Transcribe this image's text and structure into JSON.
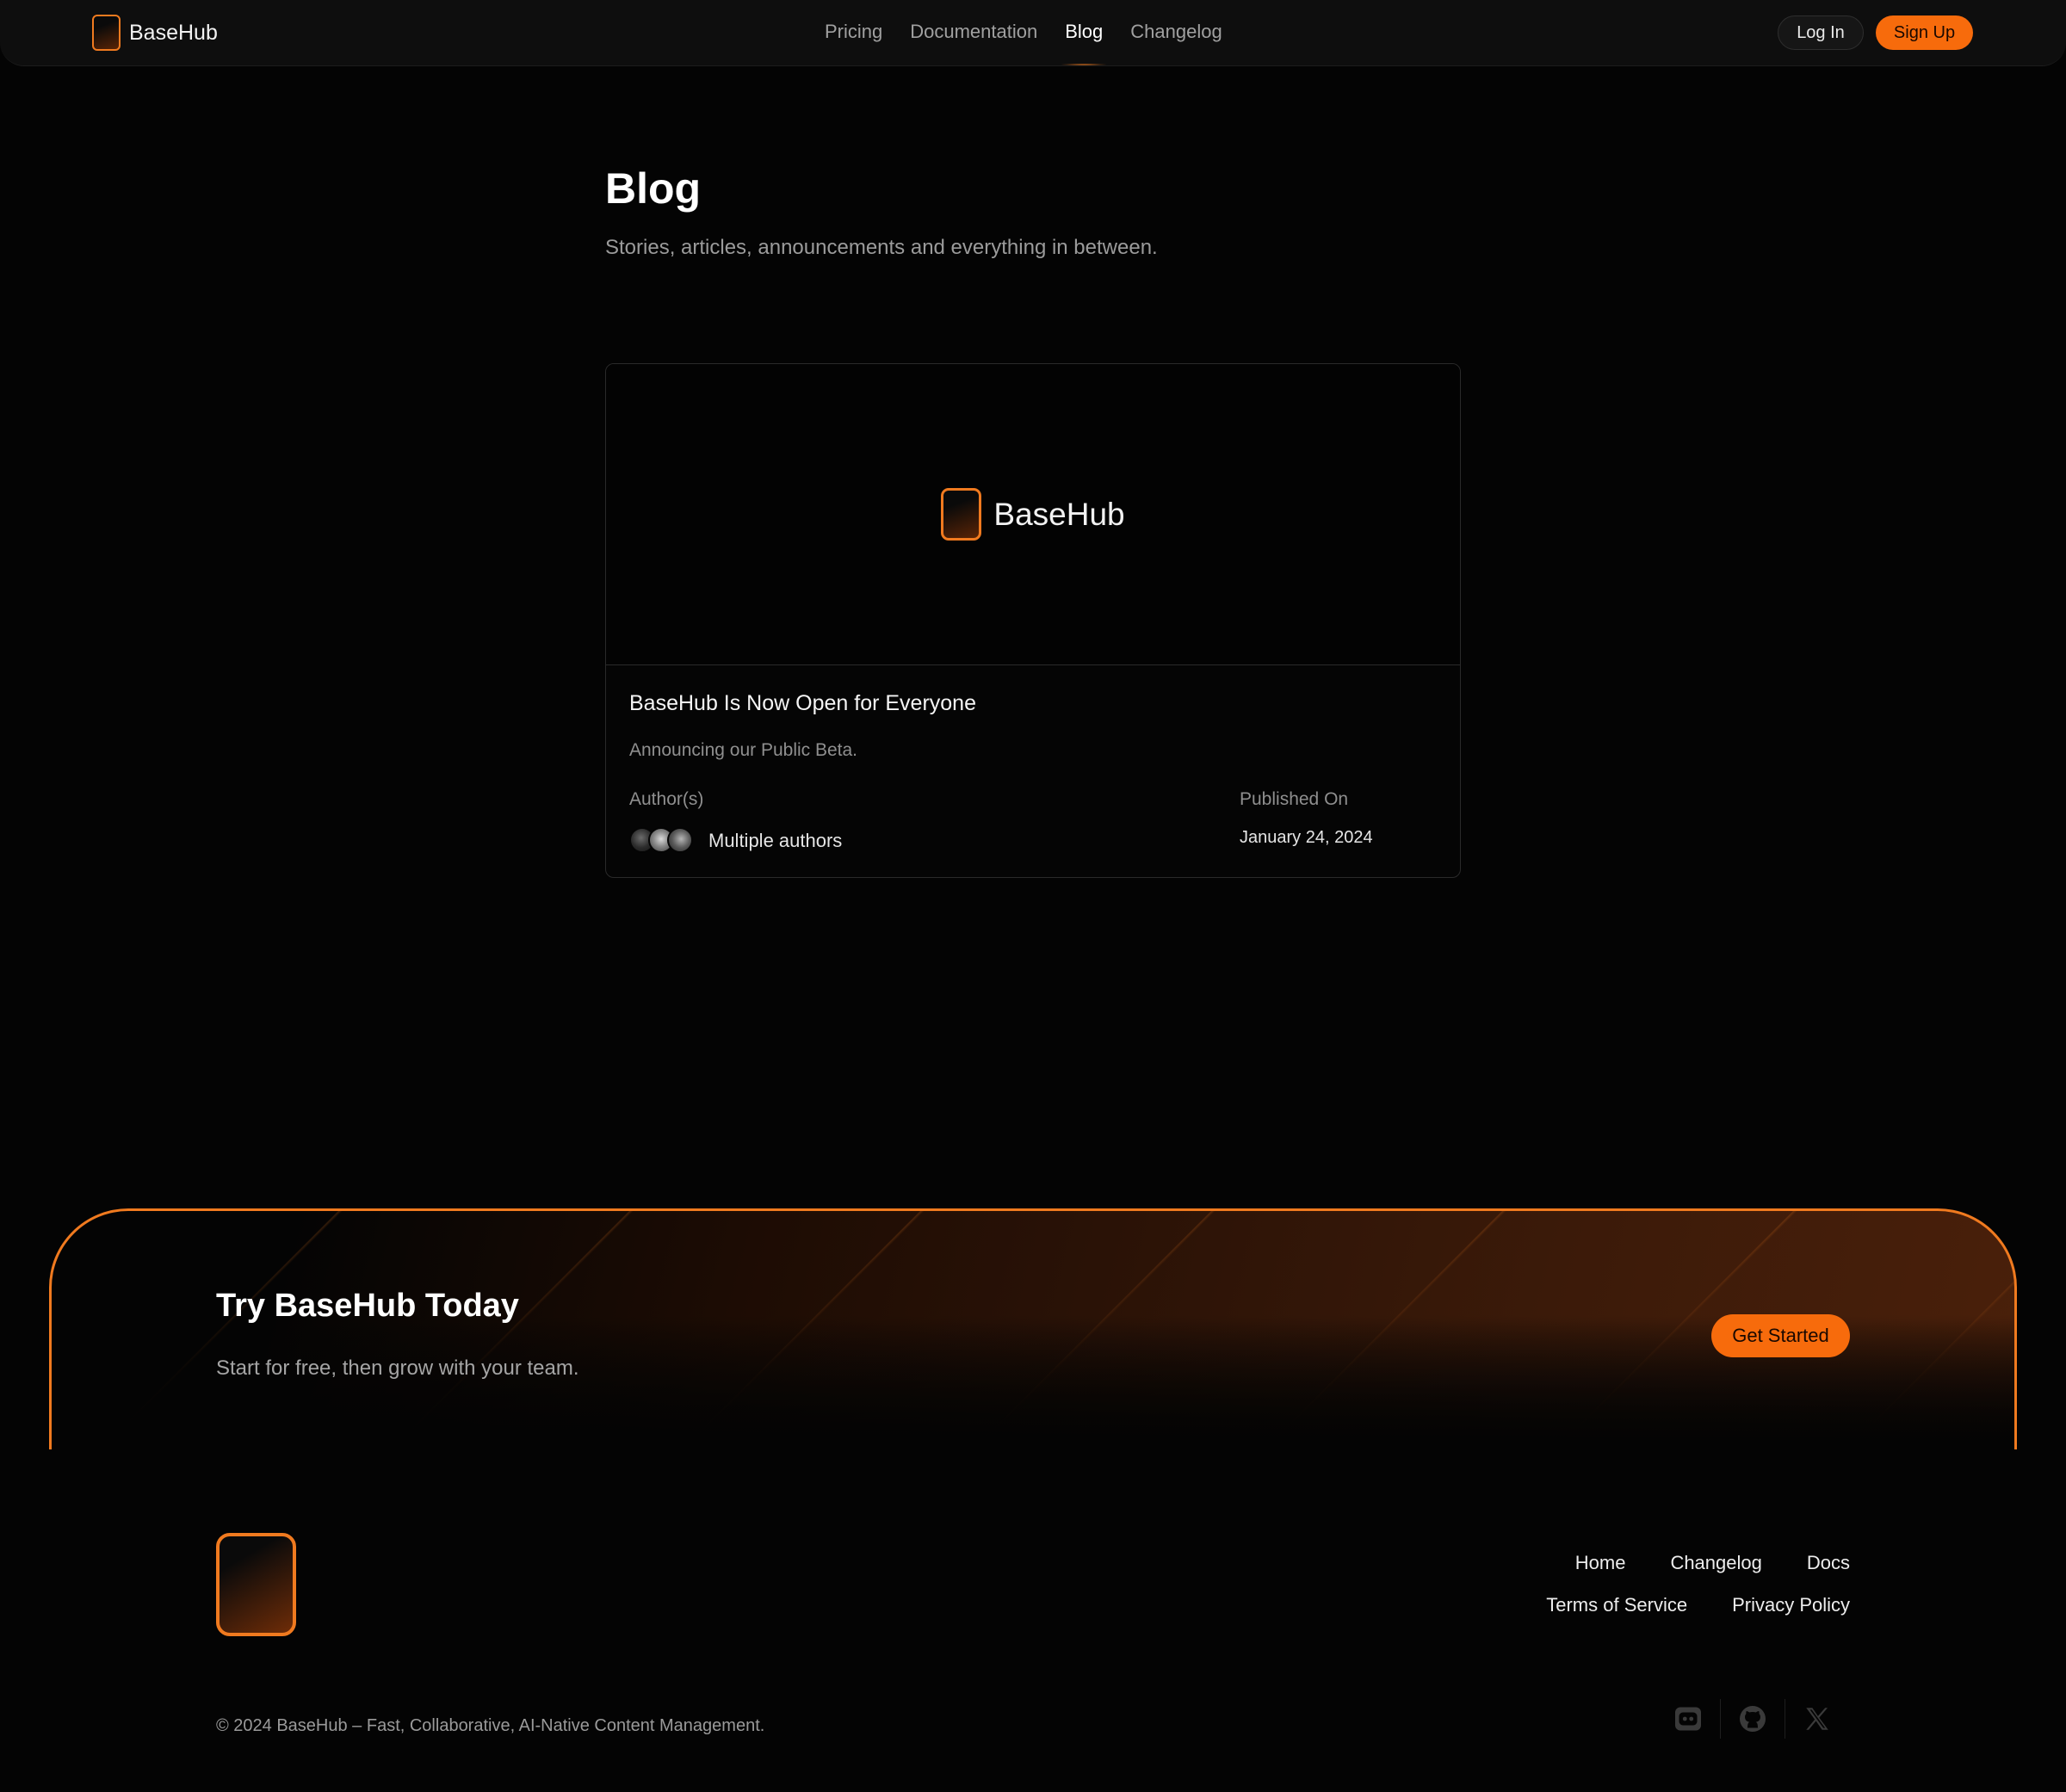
{
  "nav": {
    "brand": "BaseHub",
    "links": [
      {
        "label": "Pricing"
      },
      {
        "label": "Documentation"
      },
      {
        "label": "Blog"
      },
      {
        "label": "Changelog"
      }
    ],
    "login_label": "Log In",
    "signup_label": "Sign Up"
  },
  "header": {
    "title": "Blog",
    "subtitle": "Stories, articles, announcements and everything in between."
  },
  "post": {
    "image_brand": "BaseHub",
    "title": "BaseHub Is Now Open for Everyone",
    "excerpt": "Announcing our Public Beta.",
    "authors_label": "Author(s)",
    "authors_text": "Multiple authors",
    "published_label": "Published On",
    "published_date": "January 24, 2024"
  },
  "cta": {
    "title": "Try BaseHub Today",
    "subtitle": "Start for free, then grow with your team.",
    "button_label": "Get Started"
  },
  "footer": {
    "links_row1": [
      {
        "label": "Home"
      },
      {
        "label": "Changelog"
      },
      {
        "label": "Docs"
      }
    ],
    "links_row2": [
      {
        "label": "Terms of Service"
      },
      {
        "label": "Privacy Policy"
      }
    ],
    "copyright": "© 2024 BaseHub – Fast, Collaborative, AI-Native Content Management.",
    "socials": [
      "discord-icon",
      "github-icon",
      "x-icon"
    ]
  },
  "colors": {
    "accent": "#f76b0c",
    "accent_border": "#f07a1f",
    "background": "#040404"
  }
}
